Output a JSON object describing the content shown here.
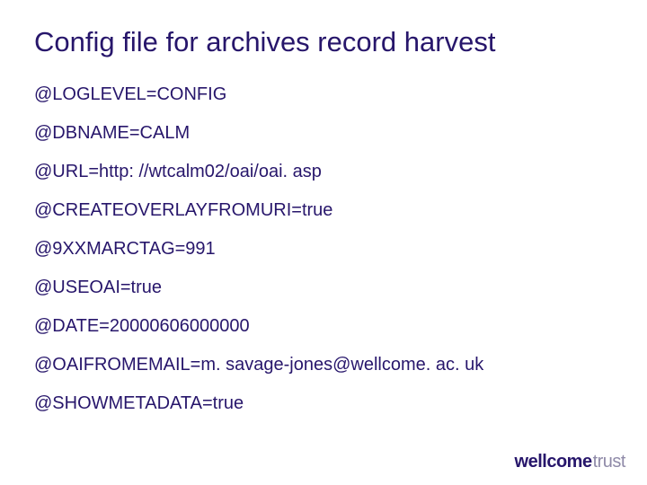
{
  "slide": {
    "title": "Config file for archives record harvest",
    "lines": [
      "@LOGLEVEL=CONFIG",
      "@DBNAME=CALM",
      "@URL=http: //wtcalm02/oai/oai. asp",
      "@CREATEOVERLAYFROMURI=true",
      "@9XXMARCTAG=991",
      "@USEOAI=true",
      "@DATE=20000606000000",
      "@OAIFROMEMAIL=m. savage-jones@wellcome. ac. uk",
      "@SHOWMETADATA=true"
    ]
  },
  "branding": {
    "logo_bold": "wellcome",
    "logo_light": "trust"
  }
}
